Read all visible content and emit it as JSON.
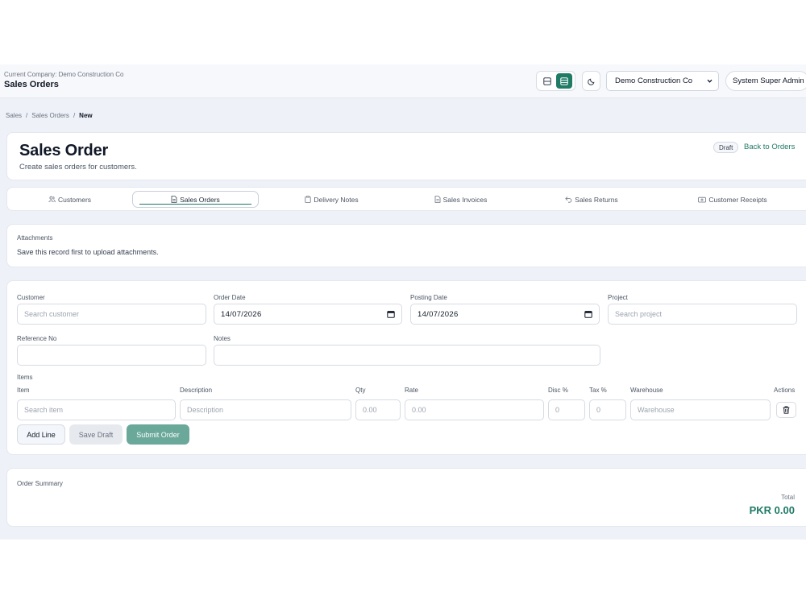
{
  "header": {
    "company_caption": "Current Company: Demo Construction Co",
    "page_title": "Sales Orders",
    "company_select": "Demo Construction Co",
    "user": "System Super Admin"
  },
  "breadcrumb": [
    "Sales",
    "/",
    "Sales Orders",
    "/",
    "New"
  ],
  "title_card": {
    "title": "Sales Order",
    "subtitle": "Create sales orders for customers.",
    "status": "Draft",
    "back_link": "Back to Orders"
  },
  "tabs": [
    {
      "label": "Customers",
      "icon": "users-icon"
    },
    {
      "label": "Sales Orders",
      "icon": "document-icon",
      "active": true
    },
    {
      "label": "Delivery Notes",
      "icon": "clipboard-icon"
    },
    {
      "label": "Sales Invoices",
      "icon": "document-icon"
    },
    {
      "label": "Sales Returns",
      "icon": "undo-icon"
    },
    {
      "label": "Customer Receipts",
      "icon": "wallet-icon"
    }
  ],
  "attachments": {
    "label": "Attachments",
    "message": "Save this record first to upload attachments."
  },
  "form": {
    "customer_label": "Customer",
    "customer_placeholder": "Search customer",
    "order_date_label": "Order Date",
    "order_date": "14/07/2026",
    "posting_date_label": "Posting Date",
    "posting_date": "14/07/2026",
    "project_label": "Project",
    "project_placeholder": "Search project",
    "reference_label": "Reference No",
    "reference_value": "",
    "notes_label": "Notes",
    "notes_value": ""
  },
  "items": {
    "section_label": "Items",
    "columns": {
      "item": "Item",
      "description": "Description",
      "qty": "Qty",
      "rate": "Rate",
      "disc": "Disc %",
      "tax": "Tax %",
      "warehouse": "Warehouse",
      "actions": "Actions"
    },
    "row": {
      "item_placeholder": "Search item",
      "description_placeholder": "Description",
      "qty_placeholder": "0.00",
      "rate_placeholder": "0.00",
      "disc_placeholder": "0",
      "tax_placeholder": "0",
      "warehouse_placeholder": "Warehouse"
    }
  },
  "buttons": {
    "add_line": "Add Line",
    "save_draft": "Save Draft",
    "submit_order": "Submit Order"
  },
  "summary": {
    "label": "Order Summary",
    "total_label": "Total",
    "total_value": "PKR 0.00"
  },
  "colors": {
    "accent": "#1f7a66",
    "submit_button": "#6aa89a",
    "app_background": "#eef2f8"
  }
}
